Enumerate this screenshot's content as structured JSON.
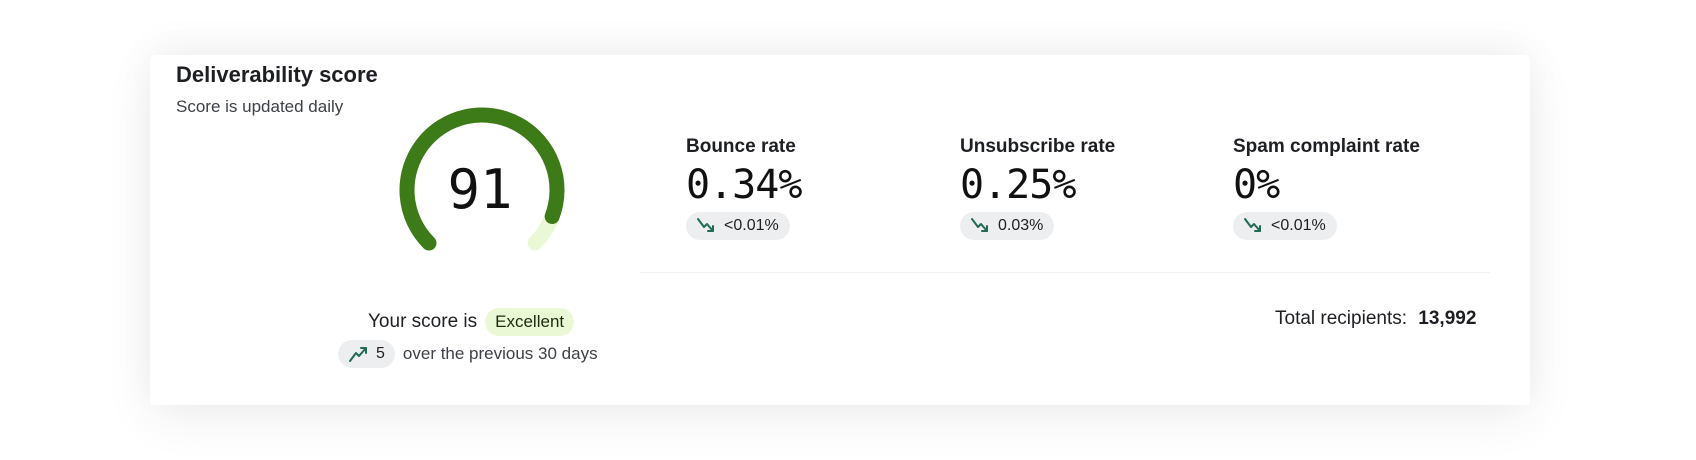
{
  "header": {
    "title": "Deliverability score",
    "subtitle": "Score is updated daily"
  },
  "gauge": {
    "value": "91",
    "score": 91,
    "max": 100,
    "fill_color": "#3d7a18",
    "track_color": "#eaf8d6"
  },
  "metrics": [
    {
      "label": "Bounce rate",
      "value": "0.34%",
      "change": "<0.01%",
      "trend_icon": "trend-down-icon"
    },
    {
      "label": "Unsubscribe rate",
      "value": "0.25%",
      "change": "0.03%",
      "trend_icon": "trend-down-icon"
    },
    {
      "label": "Spam complaint rate",
      "value": "0%",
      "change": "<0.01%",
      "trend_icon": "trend-down-icon"
    }
  ],
  "score_summary": {
    "prefix": "Your score is",
    "badge": "Excellent",
    "change_value": "5",
    "change_icon": "trend-up-icon",
    "change_suffix": "over the previous 30 days"
  },
  "recipients": {
    "label": "Total recipients:",
    "value": "13,992"
  },
  "colors": {
    "gauge_fill": "#3d7a18",
    "gauge_track": "#eaf8d6",
    "trend_icon": "#1f6b55",
    "pill_bg": "#eceef0",
    "badge_bg": "#eaf8d6"
  }
}
